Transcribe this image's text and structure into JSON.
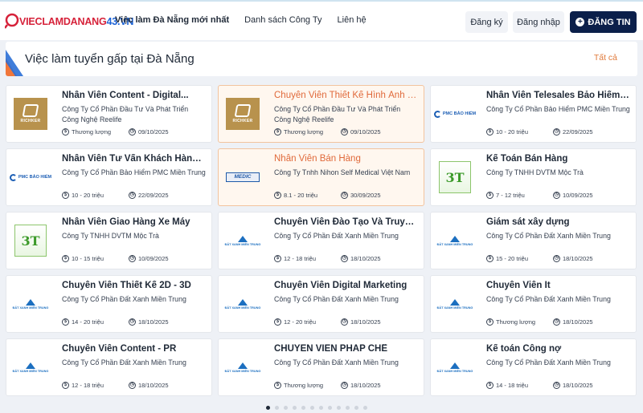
{
  "brand": {
    "logo_text_red": "VIECLAMDANANG",
    "logo_text_blue": "43.VN"
  },
  "nav": [
    "Việc làm Đà Nẵng mới nhất",
    "Danh sách Công Ty",
    "Liên hệ"
  ],
  "auth": {
    "register": "Đăng ký",
    "login": "Đăng nhập",
    "post_job": "ĐĂNG TIN"
  },
  "section": {
    "title": "Việc làm tuyển gấp tại Đà Nẵng",
    "see_all": "Tất cả"
  },
  "jobs": [
    {
      "title": "Nhân Viên Content - Digital...",
      "company": "Công Ty Cổ Phần Đầu Tư Và Phát Triển Công Nghệ Reelife",
      "salary": "Thương lượng",
      "date": "09/10/2025",
      "logo": "richker",
      "logo_text": "RICHKER",
      "highlight": false
    },
    {
      "title": "Chuyên Viên Thiết Kế Hình Ảnh - E...",
      "company": "Công Ty Cổ Phần Đầu Tư Và Phát Triển Công Nghệ Reelife",
      "salary": "Thương lượng",
      "date": "09/10/2025",
      "logo": "richker",
      "logo_text": "RICHKER",
      "highlight": true
    },
    {
      "title": "Nhân Viên Telesales Bảo Hiểm Ô Tô",
      "company": "Công Ty Cổ Phần Bảo Hiểm PMC Miền Trung",
      "salary": "10 - 20 triệu",
      "date": "22/09/2025",
      "logo": "pmc",
      "logo_text": "PMC BẢO HIỂM",
      "highlight": false
    },
    {
      "title": "Nhân Viên Tư Vấn Khách Hàng Qua...",
      "company": "Công Ty Cổ Phần Bảo Hiểm PMC Miền Trung",
      "salary": "10 - 20 triệu",
      "date": "22/09/2025",
      "logo": "pmc",
      "logo_text": "PMC BẢO HIỂM",
      "highlight": false
    },
    {
      "title": "Nhân Viên Bán Hàng",
      "company": "Công Ty Tnhh Nihon Self Medical Việt Nam",
      "salary": "8.1 - 20 triệu",
      "date": "30/09/2025",
      "logo": "medic",
      "logo_text": "MEDIC",
      "highlight": true
    },
    {
      "title": "Kế Toán Bán Hàng",
      "company": "Công Ty TNHH DVTM Mộc Trà",
      "salary": "7 - 12 triệu",
      "date": "10/09/2025",
      "logo": "mt",
      "logo_text": "3T",
      "highlight": false
    },
    {
      "title": "Nhân Viên Giao Hàng Xe Máy",
      "company": "Công Ty TNHH DVTM Mộc Trà",
      "salary": "10 - 15 triệu",
      "date": "10/09/2025",
      "logo": "mt",
      "logo_text": "3T",
      "highlight": false
    },
    {
      "title": "Chuyên Viên Đào Tạo Và Truyền...",
      "company": "Công Ty Cổ Phần Đất Xanh Miền Trung",
      "salary": "12 - 18 triệu",
      "date": "18/10/2025",
      "logo": "dx",
      "logo_text": "ĐẤT XANH MIỀN TRUNG",
      "highlight": false
    },
    {
      "title": "Giám sát xây dựng",
      "company": "Công Ty Cổ Phần Đất Xanh Miền Trung",
      "salary": "15 - 20 triệu",
      "date": "18/10/2025",
      "logo": "dx",
      "logo_text": "ĐẤT XANH MIỀN TRUNG",
      "highlight": false
    },
    {
      "title": "Chuyên Viên Thiết Kế 2D - 3D",
      "company": "Công Ty Cổ Phần Đất Xanh Miền Trung",
      "salary": "14 - 20 triệu",
      "date": "18/10/2025",
      "logo": "dx",
      "logo_text": "ĐẤT XANH MIỀN TRUNG",
      "highlight": false
    },
    {
      "title": "Chuyên Viên Digital Marketing",
      "company": "Công Ty Cổ Phần Đất Xanh Miền Trung",
      "salary": "12 - 20 triệu",
      "date": "18/10/2025",
      "logo": "dx",
      "logo_text": "ĐẤT XANH MIỀN TRUNG",
      "highlight": false
    },
    {
      "title": "Chuyên Viên It",
      "company": "Công Ty Cổ Phần Đất Xanh Miền Trung",
      "salary": "Thương lượng",
      "date": "18/10/2025",
      "logo": "dx",
      "logo_text": "ĐẤT XANH MIỀN TRUNG",
      "highlight": false
    },
    {
      "title": "Chuyên Viên Content - PR",
      "company": "Công Ty Cổ Phần Đất Xanh Miền Trung",
      "salary": "12 - 18 triệu",
      "date": "18/10/2025",
      "logo": "dx",
      "logo_text": "ĐẤT XANH MIỀN TRUNG",
      "highlight": false
    },
    {
      "title": "CHUYÊN VIÊN PHÁP CHẾ",
      "company": "Công Ty Cổ Phần Đất Xanh Miền Trung",
      "salary": "Thương lượng",
      "date": "18/10/2025",
      "logo": "dx",
      "logo_text": "ĐẤT XANH MIỀN TRUNG",
      "highlight": false
    },
    {
      "title": "Kế toán Công nợ",
      "company": "Công Ty Cổ Phần Đất Xanh Miền Trung",
      "salary": "14 - 18 triệu",
      "date": "18/10/2025",
      "logo": "dx",
      "logo_text": "ĐẤT XANH MIỀN TRUNG",
      "highlight": false
    }
  ],
  "pager": {
    "pages": 12,
    "current": 1
  },
  "colors": {
    "accent": "#e0693a",
    "brand_dark": "#0b1f4a",
    "logo_red": "#d6223a",
    "logo_blue": "#1d63d6"
  }
}
